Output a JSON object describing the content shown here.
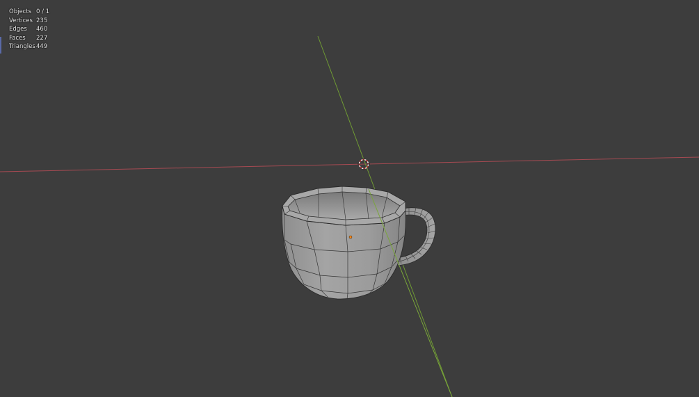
{
  "stats": [
    {
      "label": "Objects",
      "value": "0 / 1"
    },
    {
      "label": "Vertices",
      "value": "235"
    },
    {
      "label": "Edges",
      "value": "460"
    },
    {
      "label": "Faces",
      "value": "227"
    },
    {
      "label": "Triangles",
      "value": "449"
    }
  ],
  "colors": {
    "background": "#3d3d3d",
    "x_axis": "#a54a52",
    "y_axis": "#6f9a34",
    "mesh_fill": "#9a9a9a",
    "wire": "#2a2a2a",
    "origin": "#ff8a1a"
  }
}
